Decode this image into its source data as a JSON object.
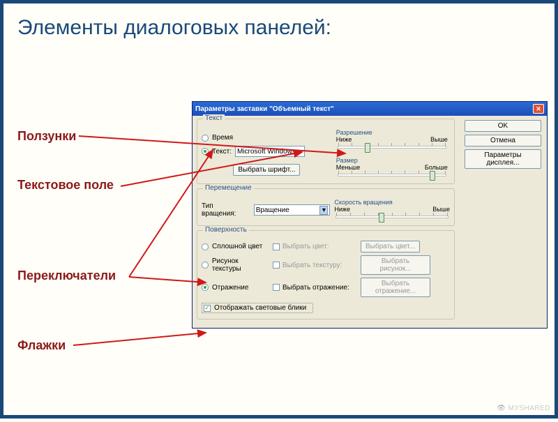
{
  "slide": {
    "title": "Элементы диалоговых панелей:",
    "labels": {
      "sliders": "Ползунки",
      "textfield": "Текстовое поле",
      "radios": "Переключатели",
      "checkboxes": "Флажки"
    },
    "watermark": "МУSНАRED"
  },
  "dialog": {
    "title": "Параметры заставки \"Объемный текст\"",
    "buttons": {
      "ok": "OK",
      "cancel": "Отмена",
      "display_params": "Параметры дисплея..."
    },
    "group_text": {
      "legend": "Текст",
      "radio_time": "Время",
      "radio_text": "Текст:",
      "text_value": "Microsoft Windows",
      "choose_font": "Выбрать шрифт...",
      "resolution": {
        "legend": "Разрешение",
        "low": "Ниже",
        "high": "Выше"
      },
      "size": {
        "legend": "Размер",
        "low": "Меньше",
        "high": "Больше"
      }
    },
    "group_move": {
      "legend": "Перемещение",
      "spin_label": "Тип вращения:",
      "spin_value": "Вращение",
      "speed": {
        "legend": "Скорость вращения",
        "low": "Ниже",
        "high": "Выше"
      }
    },
    "group_surface": {
      "legend": "Поверхность",
      "radio_solid": "Сплошной цвет",
      "radio_texture": "Рисунок текстуры",
      "radio_reflect": "Отражение",
      "chk_color": "Выбрать цвет:",
      "chk_texture": "Выбрать текстуру:",
      "chk_reflect": "Выбрать отражение:",
      "btn_color": "Выбрать цвет...",
      "btn_texture": "Выбрать рисунок...",
      "btn_reflect": "Выбрать отражение...",
      "chk_glare": "Отображать световые блики"
    }
  }
}
